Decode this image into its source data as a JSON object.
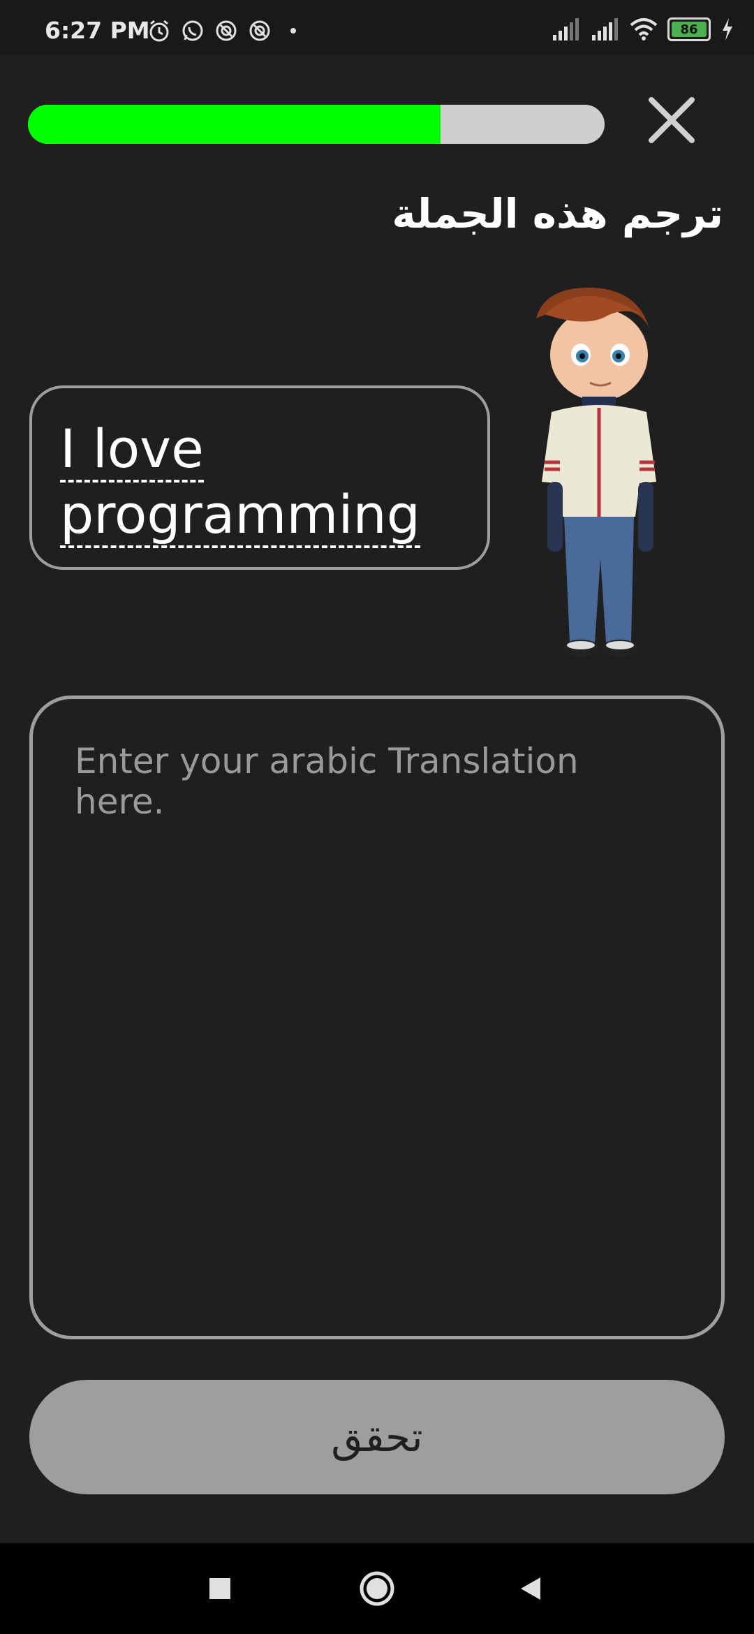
{
  "status_bar": {
    "time": "6:27 PM",
    "battery": "86",
    "icons_left": [
      "alarm-icon",
      "whatsapp-icon",
      "app-icon",
      "app-icon",
      "dot-icon"
    ],
    "icons_right": [
      "signal-icon",
      "signal-icon",
      "wifi-icon",
      "battery-icon",
      "charging-icon"
    ]
  },
  "progress": {
    "value": 0.715,
    "fill_color": "#00ff00",
    "track_color": "#cfcfcf"
  },
  "close_icon": "close-icon",
  "instruction": "ترجم هذه الجملة",
  "sentence": {
    "line1": "I love",
    "line2": "programming"
  },
  "character": "boy-character-image",
  "translation": {
    "placeholder": "Enter your arabic Translation here.",
    "value": ""
  },
  "check_button": {
    "label": "تحقق"
  },
  "navigation": [
    "recents-icon",
    "home-icon",
    "back-icon"
  ]
}
